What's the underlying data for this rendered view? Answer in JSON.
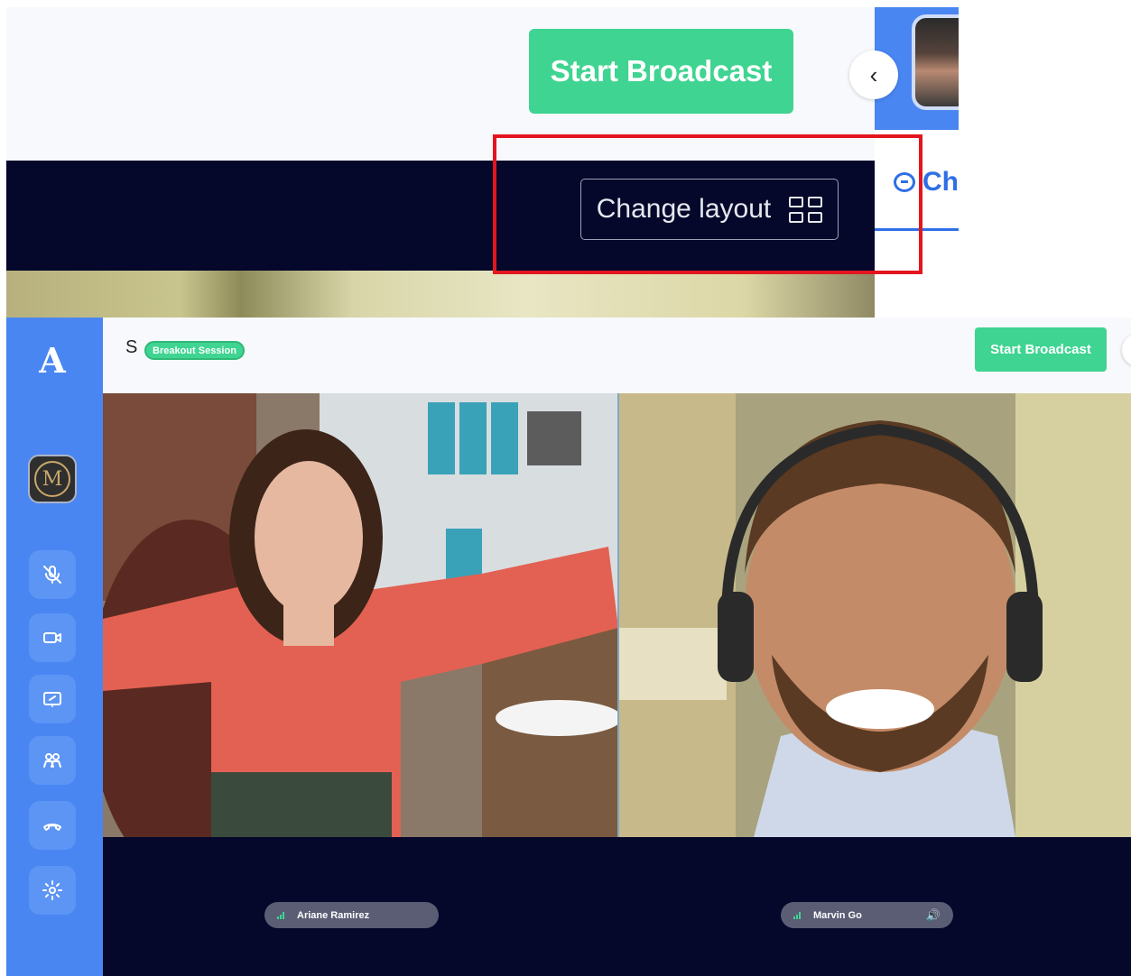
{
  "zoom": {
    "start_broadcast_label": "Start Broadcast",
    "collapse_glyph": "‹",
    "change_layout_label": "Change layout",
    "chat_tab_label": "Ch"
  },
  "sidebar": {
    "logo_glyph": "A",
    "org_avatar_glyph": "M",
    "buttons": [
      {
        "name": "mic-off-icon"
      },
      {
        "name": "camera-icon"
      },
      {
        "name": "screen-share-icon"
      },
      {
        "name": "participants-icon"
      },
      {
        "name": "hang-up-icon"
      },
      {
        "name": "settings-icon"
      }
    ]
  },
  "header": {
    "session_title": "S",
    "session_badge": "Breakout Session",
    "start_broadcast_label": "Start Broadcast"
  },
  "participants": [
    {
      "name": "Ariane Ramirez",
      "speaker": false
    },
    {
      "name": "Marvin Go",
      "speaker": true
    }
  ],
  "colors": {
    "accent_green": "#3fd491",
    "sidebar_blue": "#4a86f2",
    "stage_navy": "#05082a",
    "highlight_red": "#e3161f"
  }
}
